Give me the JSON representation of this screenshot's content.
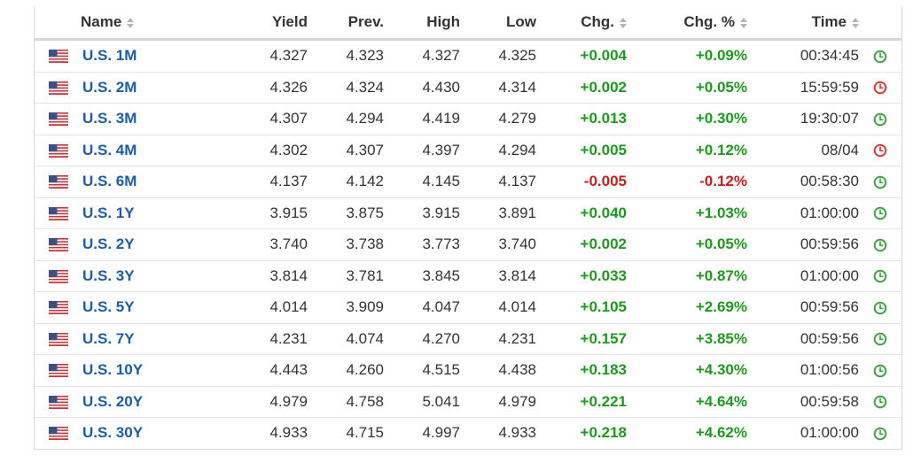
{
  "headers": {
    "name": "Name",
    "yield": "Yield",
    "prev": "Prev.",
    "high": "High",
    "low": "Low",
    "chg": "Chg.",
    "chg_pct": "Chg. %",
    "time": "Time"
  },
  "colors": {
    "positive": "#1d9a1d",
    "negative": "#cc1d1d",
    "link": "#1b5da6",
    "clock_open": "#3da53d",
    "clock_closed": "#d43b3b"
  },
  "rows": [
    {
      "flag_icon": "us-flag-icon",
      "name": "U.S. 1M",
      "yield": "4.327",
      "prev": "4.323",
      "high": "4.327",
      "low": "4.325",
      "chg": "+0.004",
      "chg_pct": "+0.09%",
      "time": "00:34:45",
      "direction": "pos",
      "clock": "open"
    },
    {
      "flag_icon": "us-flag-icon",
      "name": "U.S. 2M",
      "yield": "4.326",
      "prev": "4.324",
      "high": "4.430",
      "low": "4.314",
      "chg": "+0.002",
      "chg_pct": "+0.05%",
      "time": "15:59:59",
      "direction": "pos",
      "clock": "closed"
    },
    {
      "flag_icon": "us-flag-icon",
      "name": "U.S. 3M",
      "yield": "4.307",
      "prev": "4.294",
      "high": "4.419",
      "low": "4.279",
      "chg": "+0.013",
      "chg_pct": "+0.30%",
      "time": "19:30:07",
      "direction": "pos",
      "clock": "open"
    },
    {
      "flag_icon": "us-flag-icon",
      "name": "U.S. 4M",
      "yield": "4.302",
      "prev": "4.307",
      "high": "4.397",
      "low": "4.294",
      "chg": "+0.005",
      "chg_pct": "+0.12%",
      "time": "08/04",
      "direction": "pos",
      "clock": "closed"
    },
    {
      "flag_icon": "us-flag-icon",
      "name": "U.S. 6M",
      "yield": "4.137",
      "prev": "4.142",
      "high": "4.145",
      "low": "4.137",
      "chg": "-0.005",
      "chg_pct": "-0.12%",
      "time": "00:58:30",
      "direction": "neg",
      "clock": "open"
    },
    {
      "flag_icon": "us-flag-icon",
      "name": "U.S. 1Y",
      "yield": "3.915",
      "prev": "3.875",
      "high": "3.915",
      "low": "3.891",
      "chg": "+0.040",
      "chg_pct": "+1.03%",
      "time": "01:00:00",
      "direction": "pos",
      "clock": "open"
    },
    {
      "flag_icon": "us-flag-icon",
      "name": "U.S. 2Y",
      "yield": "3.740",
      "prev": "3.738",
      "high": "3.773",
      "low": "3.740",
      "chg": "+0.002",
      "chg_pct": "+0.05%",
      "time": "00:59:56",
      "direction": "pos",
      "clock": "open"
    },
    {
      "flag_icon": "us-flag-icon",
      "name": "U.S. 3Y",
      "yield": "3.814",
      "prev": "3.781",
      "high": "3.845",
      "low": "3.814",
      "chg": "+0.033",
      "chg_pct": "+0.87%",
      "time": "01:00:00",
      "direction": "pos",
      "clock": "open"
    },
    {
      "flag_icon": "us-flag-icon",
      "name": "U.S. 5Y",
      "yield": "4.014",
      "prev": "3.909",
      "high": "4.047",
      "low": "4.014",
      "chg": "+0.105",
      "chg_pct": "+2.69%",
      "time": "00:59:56",
      "direction": "pos",
      "clock": "open"
    },
    {
      "flag_icon": "us-flag-icon",
      "name": "U.S. 7Y",
      "yield": "4.231",
      "prev": "4.074",
      "high": "4.270",
      "low": "4.231",
      "chg": "+0.157",
      "chg_pct": "+3.85%",
      "time": "00:59:56",
      "direction": "pos",
      "clock": "open"
    },
    {
      "flag_icon": "us-flag-icon",
      "name": "U.S. 10Y",
      "yield": "4.443",
      "prev": "4.260",
      "high": "4.515",
      "low": "4.438",
      "chg": "+0.183",
      "chg_pct": "+4.30%",
      "time": "01:00:56",
      "direction": "pos",
      "clock": "open"
    },
    {
      "flag_icon": "us-flag-icon",
      "name": "U.S. 20Y",
      "yield": "4.979",
      "prev": "4.758",
      "high": "5.041",
      "low": "4.979",
      "chg": "+0.221",
      "chg_pct": "+4.64%",
      "time": "00:59:58",
      "direction": "pos",
      "clock": "open"
    },
    {
      "flag_icon": "us-flag-icon",
      "name": "U.S. 30Y",
      "yield": "4.933",
      "prev": "4.715",
      "high": "4.997",
      "low": "4.933",
      "chg": "+0.218",
      "chg_pct": "+4.62%",
      "time": "01:00:00",
      "direction": "pos",
      "clock": "open"
    }
  ]
}
